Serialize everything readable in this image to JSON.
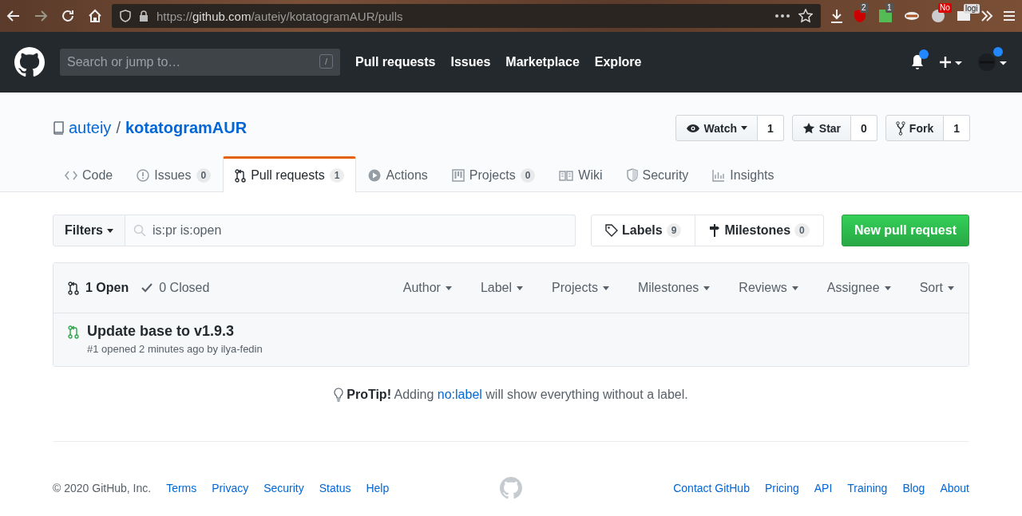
{
  "browser": {
    "url_scheme": "https://",
    "url_host": "github.com",
    "url_path": "/auteiy/kotatogramAUR/pulls",
    "extensions": [
      {
        "kind": "shield",
        "badge": "2"
      },
      {
        "kind": "square",
        "badge": "1"
      },
      {
        "kind": "tool"
      },
      {
        "kind": "circle",
        "badge": "No"
      },
      {
        "kind": "mail",
        "badge": "logi"
      }
    ]
  },
  "header": {
    "search_placeholder": "Search or jump to…",
    "search_key": "/",
    "nav": [
      "Pull requests",
      "Issues",
      "Marketplace",
      "Explore"
    ],
    "notifications_unread": true
  },
  "repo": {
    "owner": "auteiy",
    "separator": "/",
    "name": "kotatogramAUR",
    "actions": [
      {
        "kind": "watch",
        "label": "Watch",
        "count": "1"
      },
      {
        "kind": "star",
        "label": "Star",
        "count": "0"
      },
      {
        "kind": "fork",
        "label": "Fork",
        "count": "1"
      }
    ]
  },
  "tabs": [
    {
      "kind": "code",
      "label": "Code",
      "selected": false
    },
    {
      "kind": "issues",
      "label": "Issues",
      "counter": "0",
      "selected": false
    },
    {
      "kind": "pr",
      "label": "Pull requests",
      "counter": "1",
      "selected": true
    },
    {
      "kind": "actions",
      "label": "Actions",
      "selected": false
    },
    {
      "kind": "projects",
      "label": "Projects",
      "counter": "0",
      "selected": false
    },
    {
      "kind": "wiki",
      "label": "Wiki",
      "selected": false
    },
    {
      "kind": "security",
      "label": "Security",
      "selected": false
    },
    {
      "kind": "insights",
      "label": "Insights",
      "selected": false
    }
  ],
  "filter_bar": {
    "filters_label": "Filters",
    "query": "is:pr is:open",
    "labels": {
      "label": "Labels",
      "count": "9"
    },
    "milestones": {
      "label": "Milestones",
      "count": "0"
    },
    "new_button": "New pull request"
  },
  "list": {
    "states": [
      {
        "kind": "open",
        "label": "1 Open",
        "selected": true
      },
      {
        "kind": "closed",
        "label": "0 Closed",
        "selected": false
      }
    ],
    "filters": [
      "Author",
      "Label",
      "Projects",
      "Milestones",
      "Reviews",
      "Assignee",
      "Sort"
    ],
    "rows": [
      {
        "title": "Update base to v1.9.3",
        "meta": "#1 opened 2 minutes ago by ilya-fedin"
      }
    ]
  },
  "protip": {
    "text": "**ProTip!** Adding ",
    "link": "no:label",
    "rest": " will show everything without a label."
  },
  "footer": {
    "copyright": "© 2020 GitHub, Inc.",
    "left_links": [
      "Terms",
      "Privacy",
      "Security",
      "Status",
      "Help"
    ],
    "right_links": [
      "Contact GitHub",
      "Pricing",
      "API",
      "Training",
      "Blog",
      "About"
    ]
  }
}
